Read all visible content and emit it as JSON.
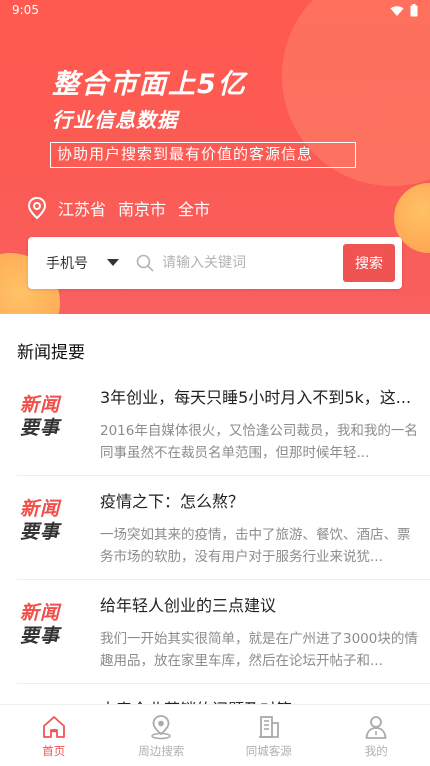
{
  "status_bar": {
    "time": "9:05"
  },
  "hero": {
    "headline": "整合市面上5亿",
    "subline": "行业信息数据",
    "tagline": "协助用户搜索到最有价值的客源信息",
    "location": {
      "province": "江苏省",
      "city": "南京市",
      "district": "全市"
    }
  },
  "search": {
    "type_label": "手机号",
    "placeholder": "请输入关键词",
    "button_label": "搜索"
  },
  "news": {
    "section_title": "新闻提要",
    "thumb_line1": "新闻",
    "thumb_line2": "要事",
    "items": [
      {
        "title": "3年创业，每天只睡5小时月入不到5k，这...",
        "desc": "2016年自媒体很火，又恰逢公司裁员，我和我的一名同事虽然不在裁员名单范围，但那时候年轻..."
      },
      {
        "title": "疫情之下：怎么熬？",
        "desc": "一场突如其来的疫情，击中了旅游、餐饮、酒店、票务市场的软肋，没有用户对于服务行业来说犹..."
      },
      {
        "title": "给年轻人创业的三点建议",
        "desc": "我们一开始其实很简单，就是在广州进了3000块的情趣用品，放在家里车库，然后在论坛开帖子和..."
      },
      {
        "title": "中竞企业营销的问题及对策",
        "desc": ""
      }
    ]
  },
  "bottom_nav": [
    {
      "label": "首页",
      "icon": "home-icon",
      "active": true
    },
    {
      "label": "周边搜索",
      "icon": "location-pin-icon",
      "active": false
    },
    {
      "label": "同城客源",
      "icon": "building-icon",
      "active": false
    },
    {
      "label": "我的",
      "icon": "user-icon",
      "active": false
    }
  ],
  "colors": {
    "accent": "#f05452",
    "hero_red": "#fb5b55",
    "orange": "#ffa24d"
  }
}
